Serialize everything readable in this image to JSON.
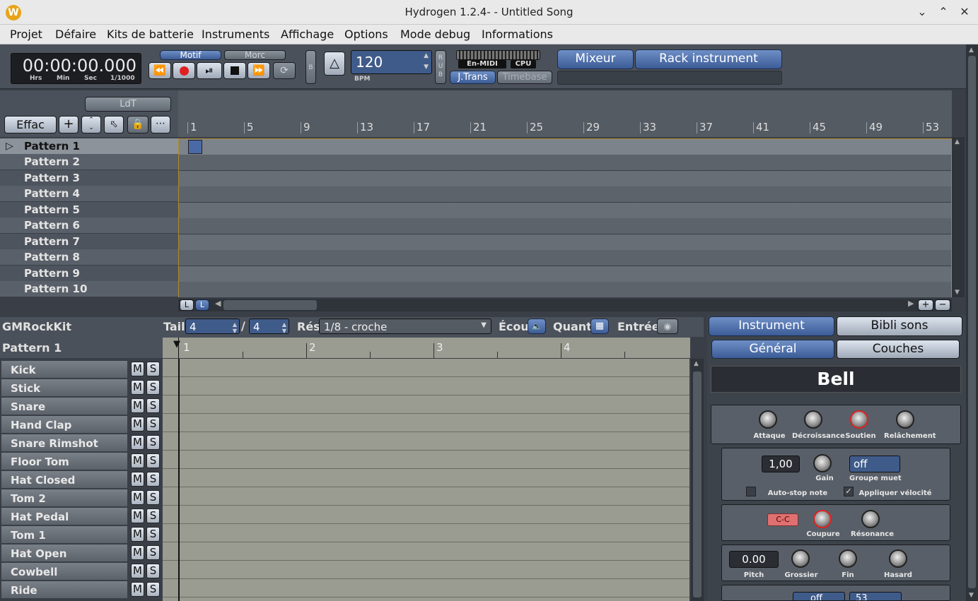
{
  "window": {
    "title": "Hydrogen 1.2.4- - Untitled Song",
    "app_icon_letter": "W"
  },
  "menu": [
    "Projet",
    "Défaire",
    "Kits de batterie",
    "Instruments",
    "Affichage",
    "Options",
    "Mode debug",
    "Informations"
  ],
  "transport": {
    "time": "00:00:00.000",
    "time_labels": [
      "Hrs",
      "Min",
      "Sec",
      "1/1000"
    ],
    "mode_pattern": "Motif",
    "mode_song": "Morc",
    "b_label": "B",
    "bpm": "120",
    "bpm_label": "BPM",
    "rub_label": "R\nU\nB",
    "midi_label": "En-MIDI",
    "cpu_label": "CPU",
    "jtrans": "J.Trans",
    "timebase": "Timebase",
    "mixer": "Mixeur",
    "rack": "Rack instrument"
  },
  "song_editor": {
    "ldt": "LdT",
    "clear": "Effac",
    "ruler_numbers": [
      "1",
      "5",
      "9",
      "13",
      "17",
      "21",
      "25",
      "29",
      "33",
      "37",
      "41",
      "45",
      "49",
      "53"
    ],
    "patterns": [
      "Pattern 1",
      "Pattern 2",
      "Pattern 3",
      "Pattern 4",
      "Pattern 5",
      "Pattern 6",
      "Pattern 7",
      "Pattern 8",
      "Pattern 9",
      "Pattern 10"
    ],
    "scroll_buttons": [
      "L",
      "L",
      "+",
      "−"
    ]
  },
  "pattern_editor": {
    "kit": "GMRockKit",
    "pattern": "Pattern 1",
    "size_label": "Tail",
    "size_num": "4",
    "size_den": "4",
    "res_label": "Rés",
    "res_value": "1/8 - croche",
    "listen_label": "Écou",
    "quant_label": "Quant",
    "input_label": "Entrée",
    "beats": [
      "1",
      "2",
      "3",
      "4"
    ],
    "instruments": [
      "Kick",
      "Stick",
      "Snare",
      "Hand Clap",
      "Snare Rimshot",
      "Floor Tom",
      "Hat Closed",
      "Tom 2",
      "Hat Pedal",
      "Tom 1",
      "Hat Open",
      "Cowbell",
      "Ride"
    ],
    "mute": "M",
    "solo": "S"
  },
  "instrument_panel": {
    "tab_instrument": "Instrument",
    "tab_library": "Bibli sons",
    "tab_general": "Général",
    "tab_layers": "Couches",
    "name": "Bell",
    "adsr": [
      "Attaque",
      "Décroissance",
      "Soutien",
      "Relâchement"
    ],
    "gain_value": "1,00",
    "gain": "Gain",
    "mute_group": "Groupe muet",
    "mute_group_value": "off",
    "auto_stop": "Auto-stop note",
    "apply_velocity": "Appliquer vélocité",
    "filter_btn": "C-C",
    "cutoff": "Coupure",
    "resonance": "Résonance",
    "pitch_value": "0.00",
    "pitch": "Pitch",
    "coarse": "Grossier",
    "fine": "Fin",
    "random": "Hasard",
    "bottom_partial": [
      "off",
      "53"
    ]
  },
  "colors": {
    "bg": "#3a3f47",
    "accent": "#4a6aa6",
    "record": "#e02020",
    "grid_border": "#b08a2c"
  }
}
